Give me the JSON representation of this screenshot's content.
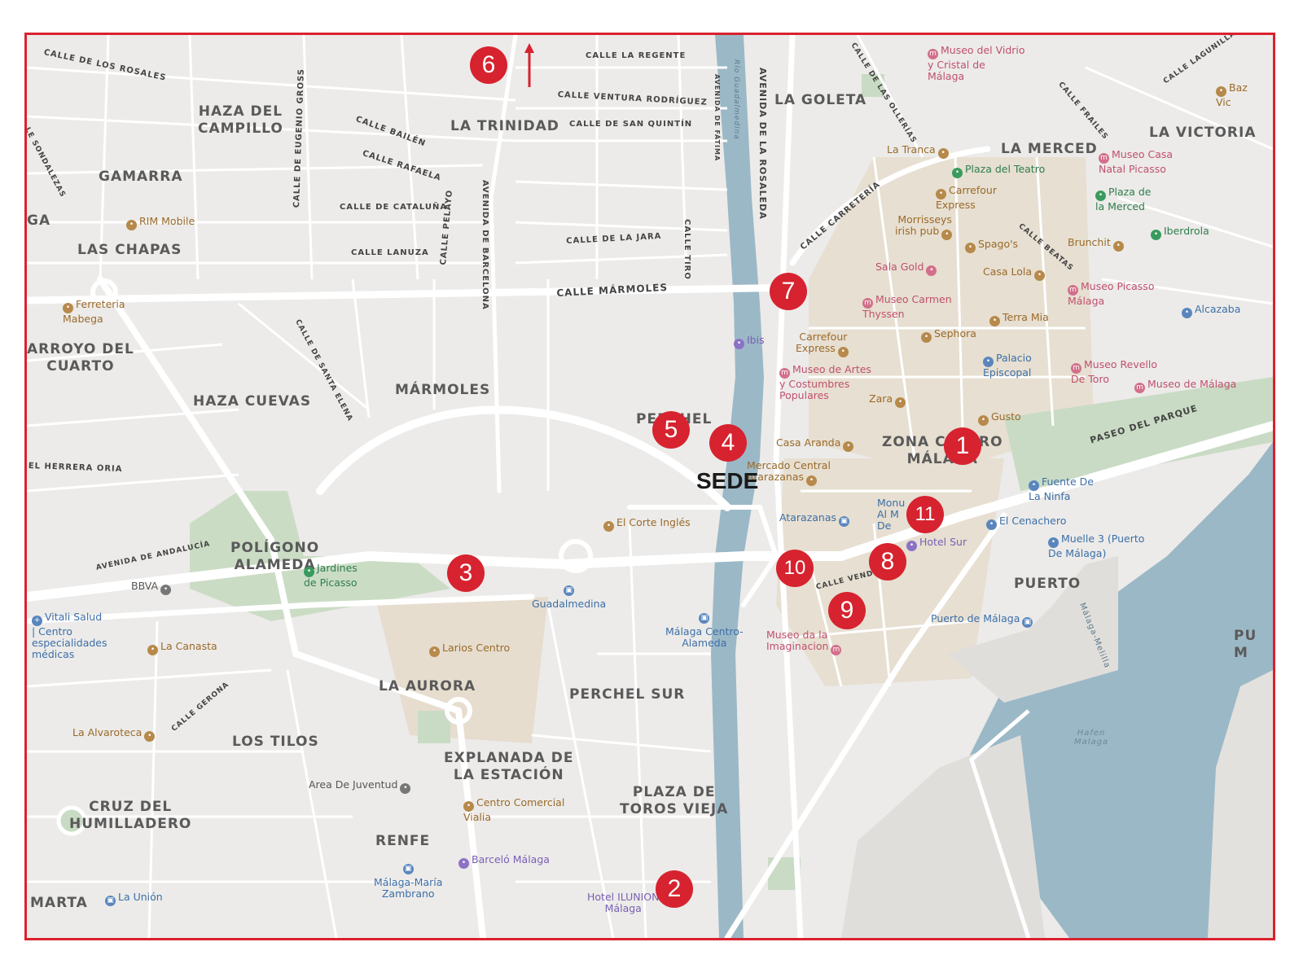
{
  "colors": {
    "frame": "#d9222f",
    "marker": "#d6232f",
    "water": "#9bb8c7",
    "park": "#c9dbc4",
    "road": "#ffffff",
    "land": "#ecebe9",
    "old_town": "#e6ded0"
  },
  "sede_label": "SEDE",
  "markers": [
    "1",
    "2",
    "3",
    "4",
    "5",
    "6",
    "7",
    "8",
    "9",
    "10",
    "11"
  ],
  "districts": {
    "haza_del_campillo": "HAZA DEL\nCAMPILLO",
    "la_trinidad": "LA TRINIDAD",
    "la_goleta": "LA GOLETA",
    "la_victoria": "LA VICTORIA",
    "la_merced": "LA MERCED",
    "gamarra": "GAMARRA",
    "ga": "GA",
    "las_chapas": "LAS CHAPAS",
    "arroyo_del_cuarto": "ARROYO DEL\nCUARTO",
    "marmoles": "MÁRMOLES",
    "haza_cuevas": "HAZA CUEVAS",
    "perchel_norte": "PERCHEL\nN",
    "zona_centro": "ZONA CENTRO\nMÁLAGA",
    "poligono_alameda": "POLÍGONO\nALAMEDA",
    "puerto": "PUERTO",
    "la_aurora": "LA AURORA",
    "perchel_sur": "PERCHEL SUR",
    "los_tilos": "LOS TILOS",
    "explanada": "EXPLANADA DE\nLA ESTACIÓN",
    "plaza_toros": "PLAZA DE\nTOROS VIEJA",
    "cruz_humilladero": "CRUZ DEL\nHUMILLADERO",
    "renfe": "RENFE",
    "marta": "MARTA",
    "pu": "PU\nM"
  },
  "streets": {
    "calle_rosales": "CALLE DE LOS ROSALES",
    "calle_regente": "CALLE LA REGENTE",
    "calle_ventura": "CALLE VENTURA RODRÍGUEZ",
    "calle_san_quintin": "CALLE DE SAN QUINTÍN",
    "calle_bailen": "CALLE BAILÉN",
    "calle_rafaela": "CALLE RAFAELA",
    "calle_cataluna": "CALLE DE CATALUÑA",
    "calle_lanuza": "CALLE LANUZA",
    "calle_jara": "CALLE DE LA JARA",
    "calle_marmoles": "CALLE MÁRMOLES",
    "calle_eugenio_gross": "CALLE DE EUGENIO GROSS",
    "calle_pelayo": "CALLE PELAYO",
    "avenida_barcelona": "AVENIDA DE BARCELONA",
    "calle_tiro": "CALLE TIRO",
    "avenida_fatima": "AVENIDA DE FÁTIMA",
    "rio_guadalmedina": "Río Guadalmedina",
    "avenida_rosaleda": "AVENIDA DE LA ROSALEDA",
    "calle_ollerias": "CALLE DE LAS OLLERÍAS",
    "calle_frailes": "CALLE FRAILES",
    "calle_lagunillas": "CALLE LAGUNILLAS",
    "calle_carreteria": "CALLE CARRETERÍA",
    "calle_beatas": "CALLE BEATAS",
    "calle_santa_elena": "CALLE DE SANTA ELENA",
    "calle_herrera_oria": "EL HERRERA ORIA",
    "avenida_andalucia": "AVENIDA DE ANDALUCÍA",
    "paseo_parque": "PASEO DEL PARQUE",
    "calle_vendeja": "CALLE VENDEJA",
    "calle_gerona": "CALLE GERONA",
    "calle_sondalezas": "LE SONDALEZAS",
    "malaga_melilla": "Málaga-Melilla",
    "hafen": "Hafen\nMalaga"
  },
  "pois": {
    "museo_vidrio": "Museo del Vidrio\ny Cristal de\nMálaga",
    "baz": "Baz\nVic",
    "la_tranca": "La Tranca",
    "plaza_teatro": "Plaza del Teatro",
    "museo_casa_natal": "Museo Casa\nNatal Picasso",
    "plaza_merced": "Plaza de\nla Merced",
    "carrefour_express_1": "Carrefour\nExpress",
    "iberdrola": "Iberdrola",
    "rim_mobile": "RIM Mobile",
    "morrisseys": "Morrisseys\nirish pub",
    "spagos": "Spago's",
    "brunchit": "Brunchit",
    "sala_gold": "Sala Gold",
    "casa_lola": "Casa Lola",
    "ferreteria": "Ferreteria\nMabega",
    "museo_carmen": "Museo Carmen\nThyssen",
    "museo_picasso": "Museo Picasso\nMálaga",
    "alcazaba": "Alcazaba",
    "terra_mia": "Terra Mia",
    "ibis": "Ibis",
    "carrefour_express_2": "Carrefour\nExpress",
    "sephora": "Sephora",
    "museo_artes": "Museo de Artes\ny Costumbres\nPopulares",
    "palacio": "Palacio\nEpiscopal",
    "museo_revello": "Museo Revello\nDe Toro",
    "museo_malaga": "Museo de Málaga",
    "zara": "Zara",
    "gusto": "Gusto",
    "casa_aranda": "Casa Aranda",
    "mercado": "Mercado Central\nAtarazanas",
    "fuente_ninfa": "Fuente De\nLa Ninfa",
    "el_corte_ingles": "El Corte Inglés",
    "atarazanas": "Atarazanas",
    "monumento": "Monu\nAl M\nDe",
    "el_cenachero": "El Cenachero",
    "muelle3": "Muelle 3 (Puerto\nDe Málaga)",
    "hotel_sur": "Hotel Sur",
    "jardines_picasso": "Jardines\nde Picasso",
    "bbva": "BBVA",
    "guadalmedina": "Guadalmedina",
    "vitali": "Vitali Salud\n| Centro\nespecialidades\nmédicas",
    "la_canasta": "La Canasta",
    "larios": "Larios Centro",
    "malaga_centro_alameda": "Málaga Centro-\nAlameda",
    "museo_imaginacion": "Museo da la\nImaginacion",
    "puerto_malaga": "Puerto de Málaga",
    "la_alvaroteca": "La Alvaroteca",
    "area_juventud": "Area De Juventud",
    "centro_vialia": "Centro Comercial\nVialia",
    "barcelo": "Barceló Málaga",
    "malaga_maria_zambrano": "Málaga-María\nZambrano",
    "la_union": "La Unión",
    "hotel_ilunion": "Hotel ILUNION\nMálaga"
  }
}
